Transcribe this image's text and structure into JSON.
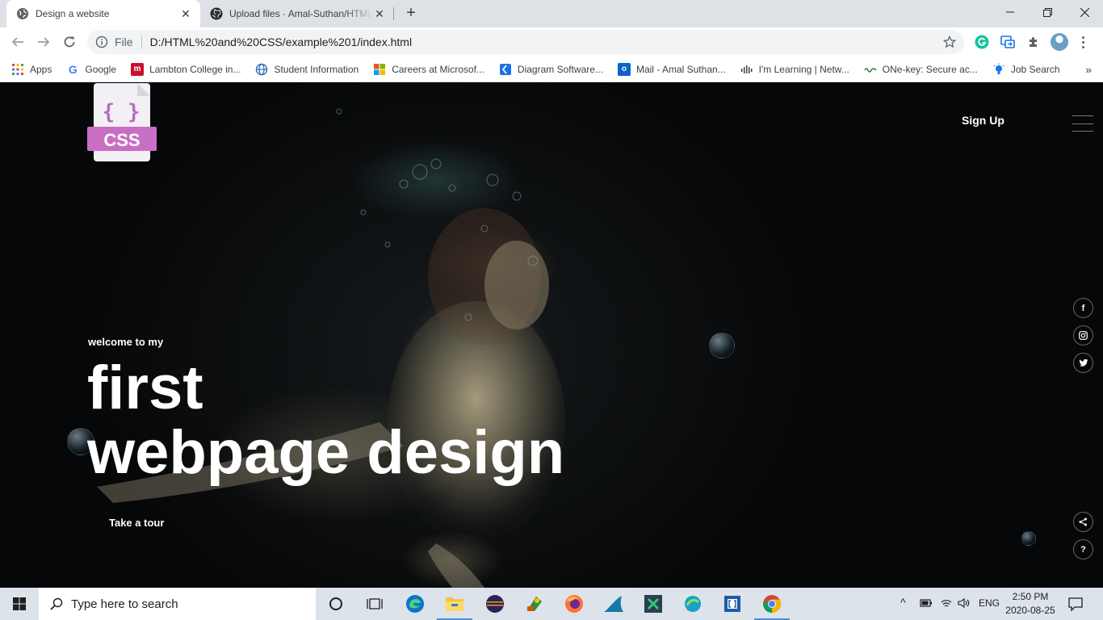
{
  "browser": {
    "tabs": [
      {
        "title": "Design a website",
        "active": true
      },
      {
        "title": "Upload files · Amal-Suthan/HTML",
        "active": false
      }
    ],
    "url_scheme_label": "File",
    "url": "D:/HTML%20and%20CSS/example%201/index.html",
    "bookmarks": [
      {
        "label": "Apps",
        "icon": "apps-grid-icon"
      },
      {
        "label": "Google",
        "icon": "google-icon"
      },
      {
        "label": "Lambton College in...",
        "icon": "lambton-icon"
      },
      {
        "label": "Student Information",
        "icon": "globe-icon"
      },
      {
        "label": "Careers at Microsof...",
        "icon": "microsoft-icon"
      },
      {
        "label": "Diagram Software...",
        "icon": "diagram-icon"
      },
      {
        "label": "Mail - Amal Suthan...",
        "icon": "outlook-icon"
      },
      {
        "label": "I'm Learning | Netw...",
        "icon": "cisco-icon"
      },
      {
        "label": "ONe-key: Secure ac...",
        "icon": "onekey-icon"
      },
      {
        "label": "Job Search",
        "icon": "bulb-icon"
      }
    ],
    "more_bookmarks": "»"
  },
  "page": {
    "logo_text": "CSS",
    "signup": "Sign Up",
    "welcome": "welcome to my",
    "headline_line1": "first",
    "headline_line2": "webpage design",
    "cta": "Take a tour",
    "social": [
      {
        "label": "f",
        "icon": "facebook-icon"
      },
      {
        "label": "◎",
        "icon": "instagram-icon"
      },
      {
        "label": "🐦",
        "icon": "twitter-icon"
      }
    ],
    "help": "?",
    "share_icon": "share-icon"
  },
  "taskbar": {
    "search_placeholder": "Type here to search",
    "language": "ENG",
    "time": "2:50 PM",
    "date": "2020-08-25"
  }
}
